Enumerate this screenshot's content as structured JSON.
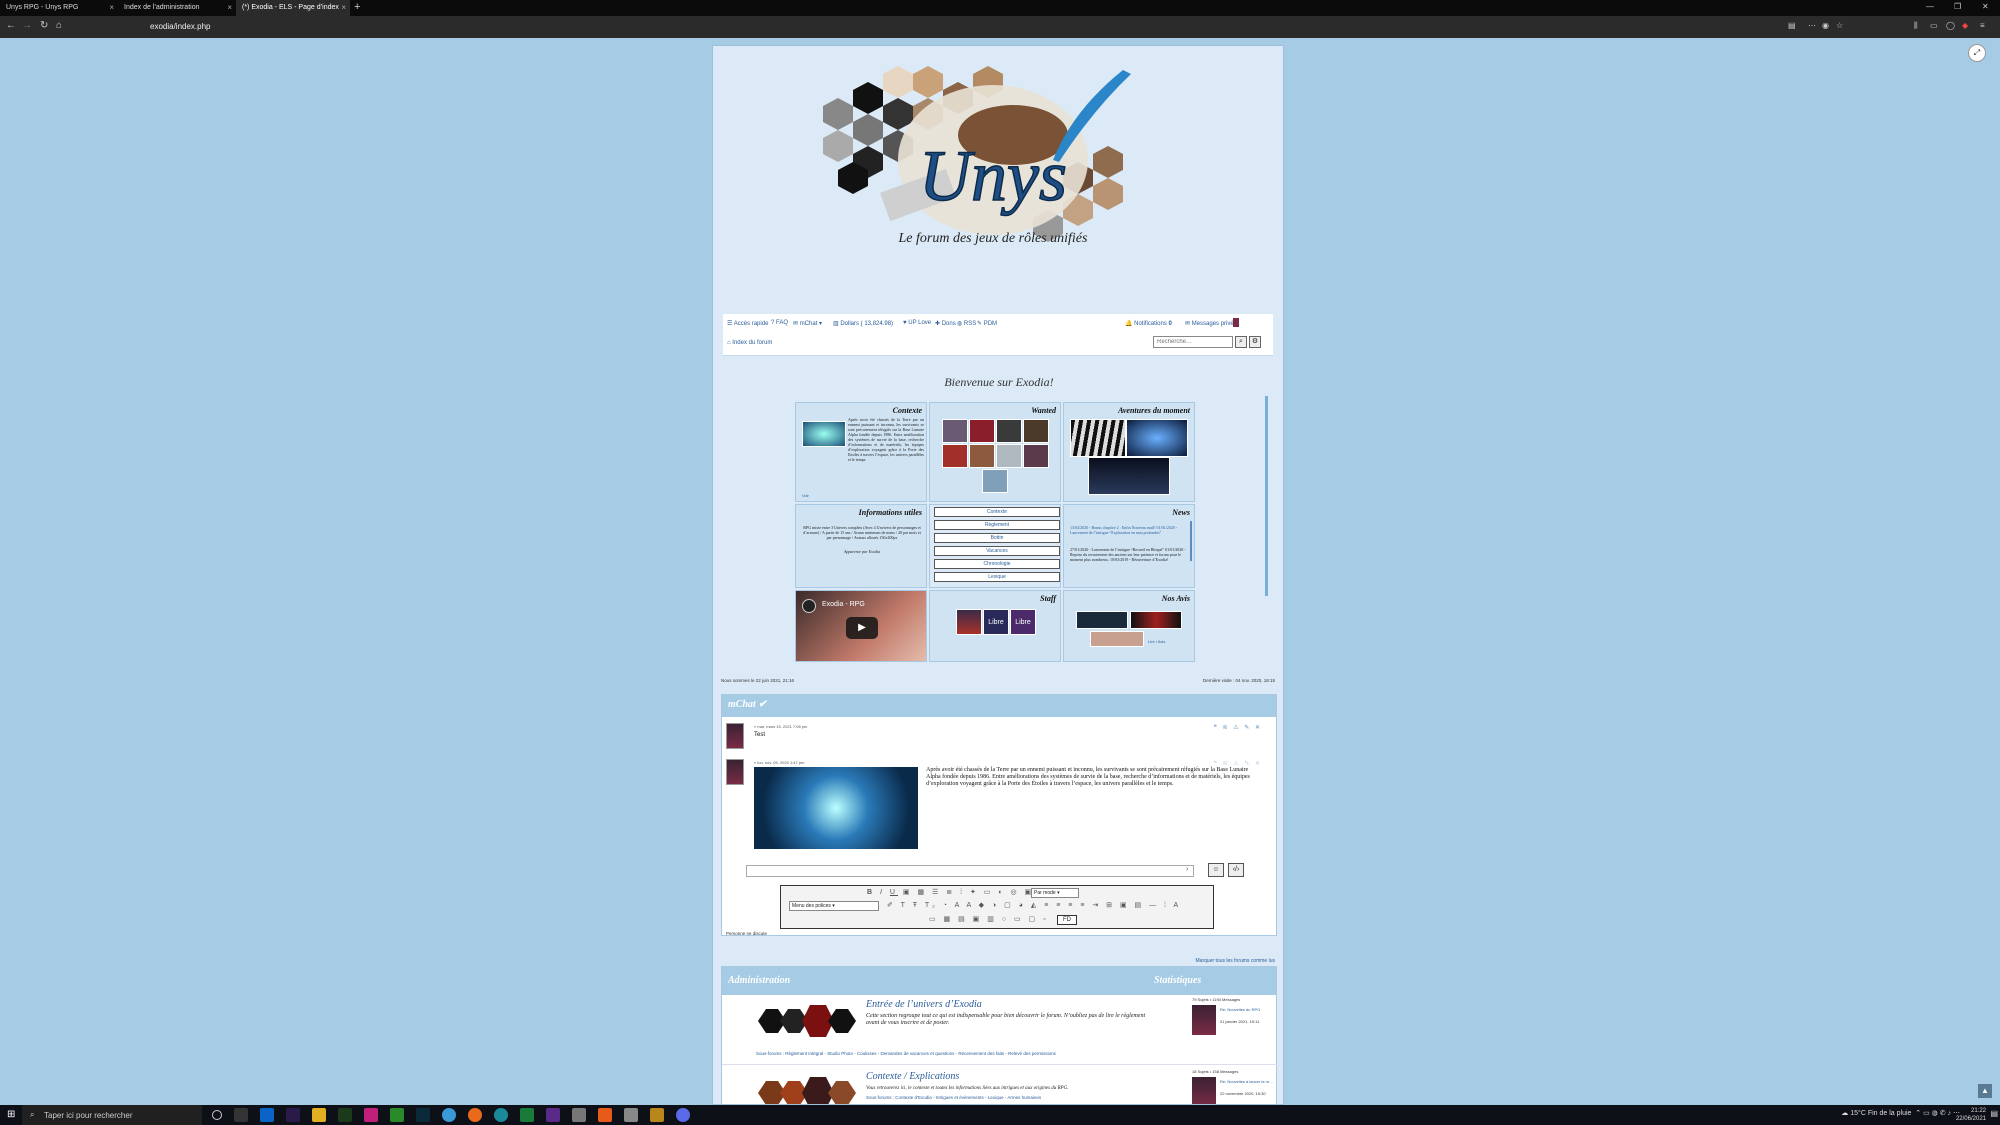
{
  "browser": {
    "tabs": [
      {
        "label": "Unys RPG - Unys RPG",
        "active": false
      },
      {
        "label": "Index de l’administration",
        "active": false
      },
      {
        "label": "(*) Exodia - ELS - Page d’index",
        "active": true
      }
    ],
    "new_tab": "+",
    "url": "exodia/index.php"
  },
  "banner": {
    "logo_text": "Unys",
    "tagline": "Le forum des jeux de rôles unifiés"
  },
  "nav": {
    "items": [
      "Accès rapide",
      "FAQ",
      "mChat",
      "Dollars ( 13,824.98)",
      "UP Love",
      "Dons",
      "RSS",
      "PDM"
    ],
    "notifications": "Notifications",
    "notif_count": "0",
    "messages": "Messages privés",
    "breadcrumb": "Index du forum",
    "search_placeholder": "Recherche…"
  },
  "welcome": "Bienvenue sur Exodia!",
  "blocks": {
    "contexte": {
      "title": "Contexte",
      "text": "Après avoir été chassés de la Terre par un ennemi puissant et inconnu, les survivants se sont précairement réfugiés sur la Base Lunaire Alpha fondée depuis 1986. Entre amélioration des systèmes de survie de la base, recherche d’informations et de matériels, les équipes d’exploration voyagent grâce à la Porte des Etoiles à travers l’espace, les univers parallèles et le temps.",
      "more": "Voir"
    },
    "wanted": {
      "title": "Wanted"
    },
    "aventures": {
      "title": "Aventures du moment"
    },
    "infos": {
      "title": "Informations utiles",
      "text": "RPG mixte entre 3 Univers complets (Avec 4 Unvivers de personnages et d’armure) / A partir de 15 ans / Avatar minimum de noms / 20 par mois et par personnage / Avatars alloués 150x200px",
      "text2": "Apparence par Exodia"
    },
    "menu": [
      "Contexte",
      "Règlement",
      "Bottin",
      "Vacances",
      "Chronologie",
      "Lexique"
    ],
    "news": {
      "title": "News",
      "items": [
        "13/04/2020 - Bonus chapitre 2 : Enfin Nouveau mail! 01/01/2020 - Lancement de l’intrigue “Exploration en ruas profondes”",
        "27/01/2020 - Lancement de l’intrigue “Recueil en Bloqué” 01/01/2020 - Reprise du recrutement des anciens sur leur patience et forum pour le moment plus nombreux. 10/03/2019 - Réouverture d’Exodia!"
      ]
    },
    "video": {
      "title": "Exodia - RPG"
    },
    "staff": {
      "title": "Staff",
      "members": [
        "Libre",
        "Libre"
      ]
    },
    "avis": {
      "title": "Nos Avis",
      "note": "Lire / Avis"
    }
  },
  "status": {
    "last_visit": "Nous sommes le 22 juin 2021, 21:16",
    "last_post": "Dernière visite : 04 nov. 2020, 18:15"
  },
  "mchat": {
    "title": "mChat",
    "messages": [
      {
        "meta": "» mar. mars 15, 2021 7:06 pm",
        "text": "Test"
      },
      {
        "meta": "» lun. nov. 09, 2020 1:47 pm",
        "text": "Après avoir été chassés de la Terre par un ennemi puissant et inconnu, les survivants se sont précairement réfugiés sur la Base Lunaire Alpha fondée depuis 1986. Entre améliorations des systèmes de survie de la base, recherche d’informations et de matériels, les équipes d’exploration voyagent grâce à la Porte des Étoiles à travers l’espace, les univers parallèles et le temps."
      }
    ],
    "font_select": "Menu des polices",
    "size_select": "Par mode",
    "fd_button": "FD",
    "who": "Personne ne discute"
  },
  "mark_read": "Marquer tous les forums comme lus",
  "admin": {
    "title": "Administration",
    "stats_title": "Statistiques",
    "forums": [
      {
        "title": "Entrée de l’univers d’Exodia",
        "desc": "Cette section regroupe tout ce qui est indispensable pour bien découvrir le forum. N’oubliez pas de lire le règlement avant de vous inscrire et de poster.",
        "subforums": "Sous-forums : Règlement Intégral - Studio Photo - Coulisses - Demandes de vacances et questions - Recensement des faits - Relevé des permissions",
        "stats": "79 Sujets • 1194 Messages",
        "last_title": "Re: Nouvelles du RPG",
        "last_date": "21 janvier 2021, 19:11"
      },
      {
        "title": "Contexte / Explications",
        "desc": "Vous retrouverez ici, le contexte et toutes les informations liées aux intrigues et aux origines du RPG.",
        "subforums": "Sous-forums : Contexte d’Exodia - Intrigues et évènements - Lexique - Armes humaines",
        "stats": "18 Sujets • 158 Messages",
        "last_title": "Re: Nouvelles à lancer la ro…",
        "last_date": "22 novembre 2020, 15:30"
      }
    ]
  },
  "taskbar": {
    "search_placeholder": "Taper ici pour rechercher",
    "weather": "15°C  Fin de la pluie",
    "time": "21:22",
    "date": "22/06/2021"
  },
  "colors": {
    "page_bg": "#a6cbe4",
    "forum_bg": "#dbeaf6",
    "link": "#2a5d9a",
    "chrome": "#2b2b2b"
  }
}
